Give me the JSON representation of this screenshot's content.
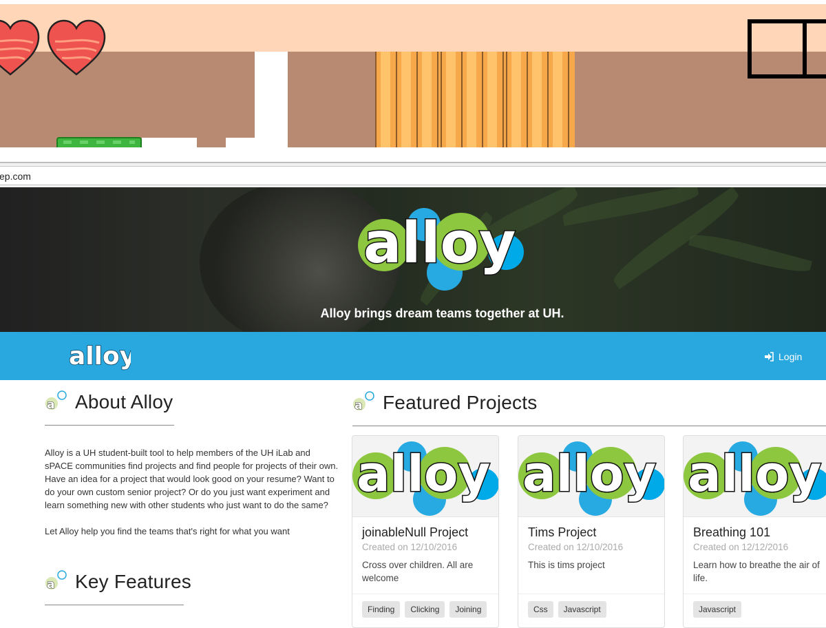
{
  "address_bar": {
    "url_fragment": "ep.com"
  },
  "hero": {
    "logo_text": "alloy",
    "tagline": "Alloy brings dream teams together at UH."
  },
  "navbar": {
    "logo_text": "alloy",
    "login_label": "Login"
  },
  "about": {
    "title": "About Alloy",
    "paragraphs": [
      "Alloy is a UH student-built tool to help members of the UH iLab and sPACE communities find projects and find people for projects of their own. Have an idea for a project that would look good on your resume? Want to do your own custom senior project? Or do you just want experiment and learn something new with other students who just want to do the same?",
      "Let Alloy help you find the teams that's right for what you want"
    ]
  },
  "key_features": {
    "title": "Key Features"
  },
  "featured": {
    "title": "Featured Projects",
    "cards": [
      {
        "title": "joinableNull Project",
        "created": "Created on 12/10/2016",
        "description": "Cross over children. All are welcome",
        "tags": [
          "Finding",
          "Clicking",
          "Joining"
        ]
      },
      {
        "title": "Tims Project",
        "created": "Created on 12/10/2016",
        "description": "This is tims project",
        "tags": [
          "Css",
          "Javascript"
        ]
      },
      {
        "title": "Breathing 101",
        "created": "Created on 12/12/2016",
        "description": "Learn how to breathe the air of life.",
        "tags": [
          "Javascript"
        ]
      }
    ]
  },
  "colors": {
    "brand_blue": "#29a8e0",
    "logo_green": "#8dc63f",
    "logo_blue": "#27a9e1",
    "game_sky": "#ffd6b8",
    "game_wall": "#b98a72"
  },
  "icons": {
    "login": "sign-in-icon",
    "heart": "heart-icon",
    "section": "alloy-mini-icon"
  }
}
